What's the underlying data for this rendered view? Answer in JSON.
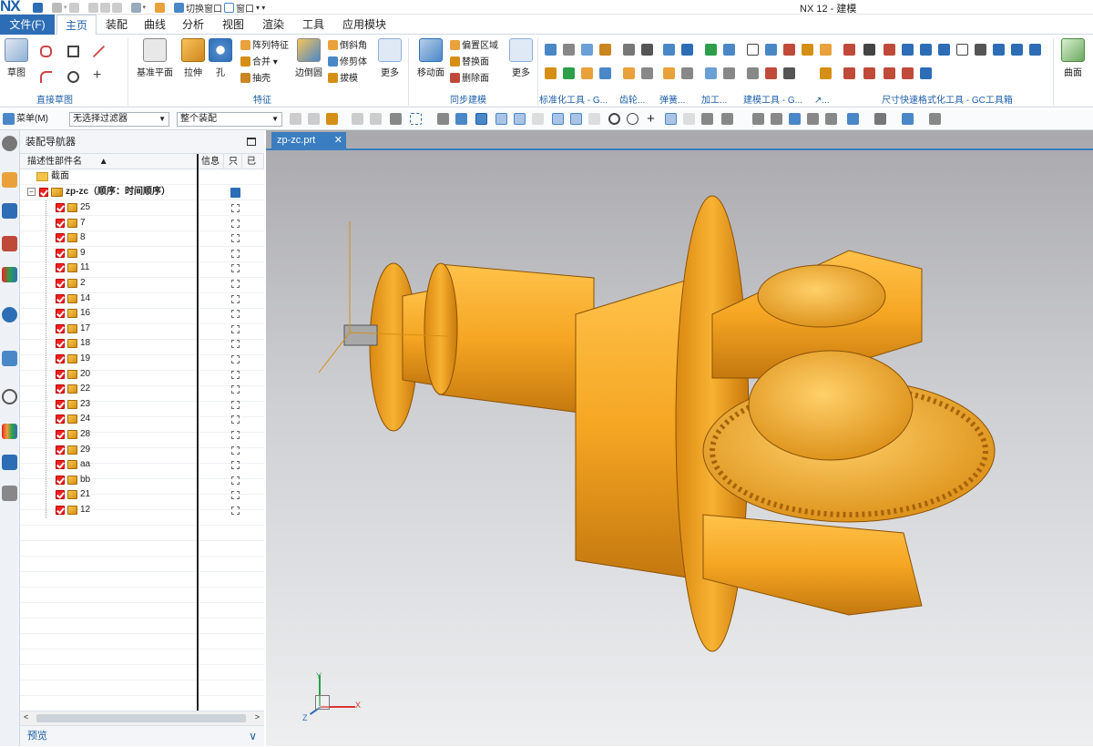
{
  "app": {
    "logo": "NX",
    "title": "NX 12 - 建模"
  },
  "quick_access": {
    "switch_window": "切换窗口",
    "window_menu": "窗口"
  },
  "menu": {
    "file": "文件(F)",
    "tabs": [
      "主页",
      "装配",
      "曲线",
      "分析",
      "视图",
      "渲染",
      "工具",
      "应用模块"
    ],
    "active_tab": "主页"
  },
  "ribbon": {
    "sketch": "草图",
    "datum_plane": "基准平面",
    "extrude": "拉伸",
    "hole": "孔",
    "pattern_feature": "阵列特征",
    "unite": "合并",
    "shell": "抽壳",
    "edge_blend": "边倒圆",
    "chamfer": "倒斜角",
    "trim_body": "修剪体",
    "draft": "拔模",
    "more1": "更多",
    "move_face": "移动面",
    "offset_region": "偏置区域",
    "replace_face": "替换面",
    "delete_face": "删除面",
    "more2": "更多",
    "groups": {
      "direct_sketch": "直接草图",
      "feature": "特征",
      "sync_modeling": "同步建模",
      "standard_tools": "标准化工具 - G...",
      "gear": "齿轮...",
      "spring": "弹簧...",
      "machining": "加工...",
      "modeling_tools": "建模工具 - G...",
      "misc": "↗...",
      "dimension_tools": "尺寸快速格式化工具 - GC工具箱",
      "surface": "曲面"
    }
  },
  "toolbar2": {
    "menu": "菜单(M)",
    "filter": "无选择过滤器",
    "scope": "整个装配"
  },
  "navigator": {
    "title": "装配导航器",
    "col_name": "描述性部件名",
    "col_info": "信息",
    "col_readonly": "只",
    "col_modified": "已",
    "section": "截面",
    "root": "zp-zc（顺序：时间顺序）",
    "parts": [
      "25",
      "7",
      "8",
      "9",
      "11",
      "2",
      "14",
      "16",
      "17",
      "18",
      "19",
      "20",
      "22",
      "23",
      "24",
      "28",
      "29",
      "aa",
      "bb",
      "21",
      "12"
    ],
    "preview": "预览"
  },
  "viewport": {
    "tab": "zp-zc.prt",
    "model_color": "#f5a623",
    "axis_x": "X",
    "axis_y": "Y",
    "axis_z": "Z"
  }
}
